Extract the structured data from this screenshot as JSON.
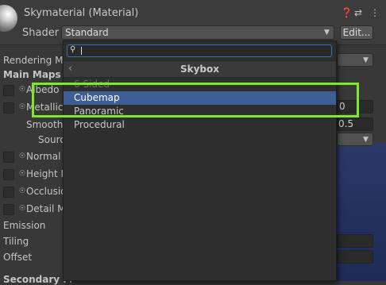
{
  "header": {
    "title": "Skymaterial (Material)",
    "shader_label": "Shader",
    "shader_value": "Standard",
    "edit_button": "Edit...",
    "icons": [
      "help-icon",
      "settings-sliders-icon",
      "more-vertical-icon"
    ]
  },
  "properties": {
    "rendering_mode_label": "Rendering Mo",
    "main_maps_label": "Main Maps",
    "albedo_label": "Albedo",
    "metallic_label": "Metallic",
    "metallic_value": "0",
    "smoothness_label": "Smoothn",
    "smoothness_value": "0.5",
    "source_label": "Sourc",
    "normal_label": "Normal I",
    "height_label": "Height M",
    "occlusion_label": "Occlusio",
    "detail_label": "Detail M",
    "emission_label": "Emission",
    "tiling_label": "Tiling",
    "offset_label": "Offset",
    "secondary_label": "Secondary M"
  },
  "popup": {
    "search_value": "",
    "category_title": "Skybox",
    "items": [
      "6 Sided",
      "Cubemap",
      "Panoramic",
      "Procedural"
    ],
    "selected_index": 1
  },
  "colors": {
    "selection": "#3e5f96",
    "highlight_box": "#7fe82a",
    "search_focus": "#3d6fb0"
  }
}
